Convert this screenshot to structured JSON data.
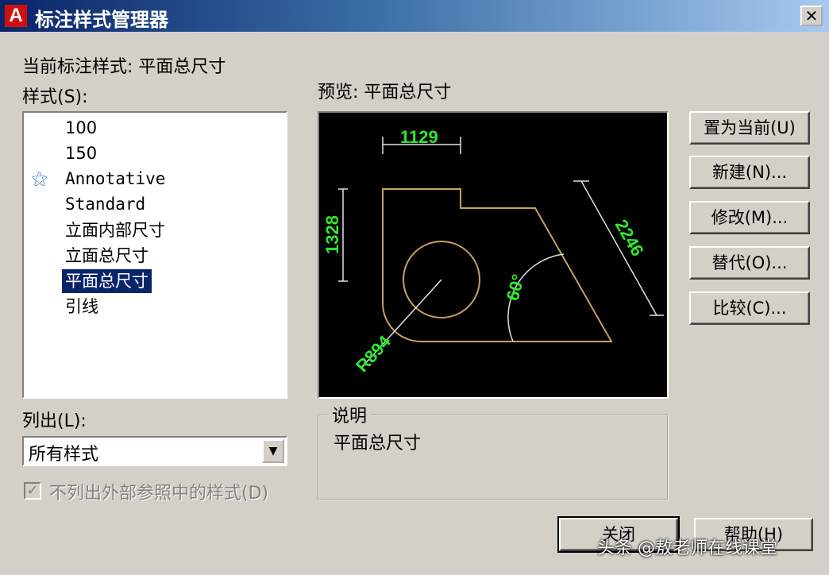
{
  "window": {
    "title": "标注样式管理器",
    "close": "✕",
    "app_icon": "A"
  },
  "current_style_label": "当前标注样式: 平面总尺寸",
  "styles_label": "样式(S):",
  "styles": [
    "100",
    "150",
    "Annotative",
    "Standard",
    "立面内部尺寸",
    "立面总尺寸",
    "平面总尺寸",
    "引线"
  ],
  "selected_style": "平面总尺寸",
  "preview_label": "预览: 平面总尺寸",
  "preview": {
    "dim_top": "1129",
    "dim_left": "1328",
    "dim_right": "2246",
    "dim_angle": "60°",
    "dim_radius": "R894",
    "geometry_color": "#c8a060",
    "dimension_color": "#2ee82e"
  },
  "list_label": "列出(L):",
  "list_value": "所有样式",
  "checkbox": {
    "label": "不列出外部参照中的样式(D)",
    "checked": true,
    "mark": "✓"
  },
  "description": {
    "title": "说明",
    "text": "平面总尺寸"
  },
  "buttons": {
    "set_current": "置为当前(U)",
    "new": "新建(N)...",
    "modify": "修改(M)...",
    "override": "替代(O)...",
    "compare": "比较(C)...",
    "close": "关闭",
    "help": "帮助(H)"
  },
  "watermark": "头条 @敖老师在线课堂",
  "colors": {
    "title_bar": "#0a246a",
    "selection": "#0a246a",
    "dialog_bg": "#d4d0c8"
  }
}
